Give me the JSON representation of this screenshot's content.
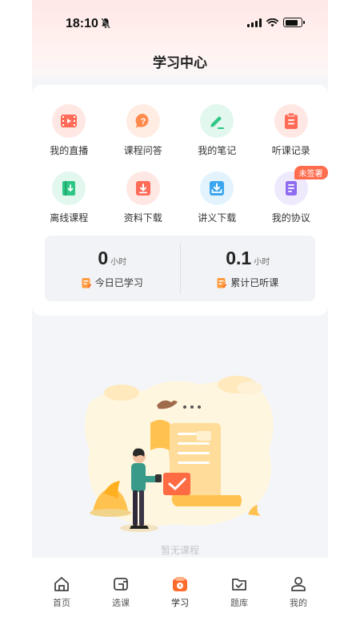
{
  "status_bar": {
    "time": "18:10"
  },
  "header": {
    "title": "学习中心"
  },
  "features": [
    {
      "label": "我的直播",
      "icon": "live-video-icon",
      "bg": "#ffe7e4",
      "color": "#ff6b57"
    },
    {
      "label": "课程问答",
      "icon": "question-bubble-icon",
      "bg": "#ffece3",
      "color": "#ff8a4c"
    },
    {
      "label": "我的笔记",
      "icon": "pencil-icon",
      "bg": "#e2f7ee",
      "color": "#2ec786"
    },
    {
      "label": "听课记录",
      "icon": "clipboard-icon",
      "bg": "#ffe7e4",
      "color": "#ff6b57"
    },
    {
      "label": "离线课程",
      "icon": "offline-book-icon",
      "bg": "#e2f7ee",
      "color": "#2ec786"
    },
    {
      "label": "资料下载",
      "icon": "download-box-icon",
      "bg": "#ffe7e4",
      "color": "#ff6b57"
    },
    {
      "label": "讲义下载",
      "icon": "download-tray-icon",
      "bg": "#e3f3fd",
      "color": "#3aa6ef"
    },
    {
      "label": "我的协议",
      "icon": "document-icon",
      "bg": "#efe9fd",
      "color": "#8e6cf1",
      "badge": "未签署"
    }
  ],
  "stats": {
    "today": {
      "value": "0",
      "unit": "小时",
      "label": "今日已学习"
    },
    "total": {
      "value": "0.1",
      "unit": "小时",
      "label": "累计已听课"
    }
  },
  "empty_state": {
    "text": "暂无课程"
  },
  "tabbar": {
    "tabs": [
      {
        "label": "首页",
        "icon": "home-icon"
      },
      {
        "label": "选课",
        "icon": "course-select-icon"
      },
      {
        "label": "学习",
        "icon": "study-icon",
        "active": true
      },
      {
        "label": "题库",
        "icon": "question-bank-icon"
      },
      {
        "label": "我的",
        "icon": "profile-icon"
      }
    ]
  },
  "colors": {
    "accent": "#ff6b2c",
    "badge": "#ff6d4f",
    "background": "#f4f5f8"
  }
}
